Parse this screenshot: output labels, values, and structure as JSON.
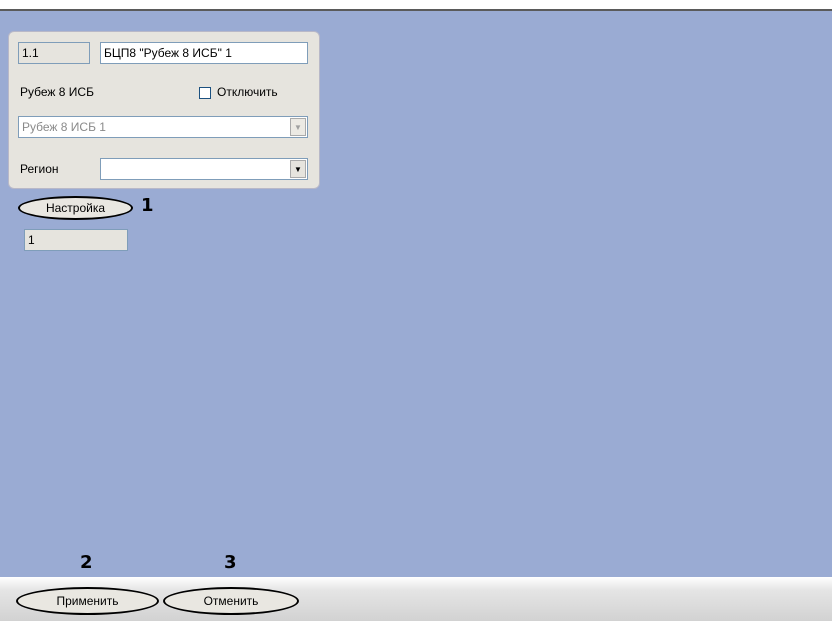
{
  "device": {
    "id_value": "1.1",
    "name_value": "БЦП8 \"Рубеж 8 ИСБ\" 1",
    "parent_label": "Рубеж 8 ИСБ",
    "disable_label": "Отключить",
    "parent_select_value": "Рубеж 8 ИСБ 1",
    "region_label": "Регион",
    "region_value": ""
  },
  "settings": {
    "button_label": "Настройка",
    "value": "1"
  },
  "footer": {
    "apply_label": "Применить",
    "cancel_label": "Отменить"
  },
  "callouts": {
    "n1": "1",
    "n2": "2",
    "n3": "3"
  },
  "icons": {
    "dropdown": "▼"
  }
}
